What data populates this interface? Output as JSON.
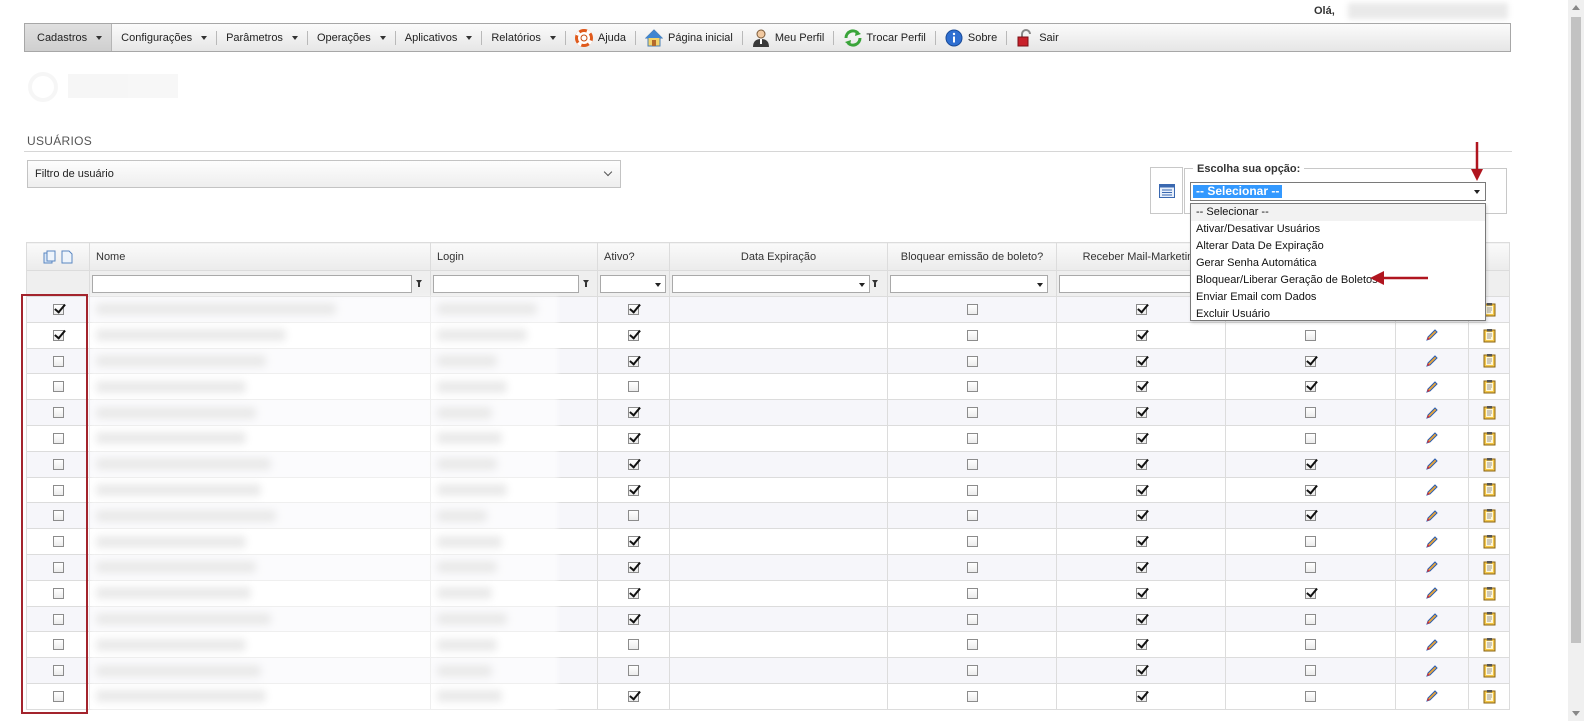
{
  "header": {
    "greeting": "Olá,"
  },
  "menu": [
    {
      "key": "cadastros",
      "label": "Cadastros",
      "caret": true,
      "icon": null
    },
    {
      "key": "configuracoes",
      "label": "Configurações",
      "caret": true,
      "icon": null
    },
    {
      "key": "parametros",
      "label": "Parâmetros",
      "caret": true,
      "icon": null
    },
    {
      "key": "operacoes",
      "label": "Operações",
      "caret": true,
      "icon": null
    },
    {
      "key": "aplicativos",
      "label": "Aplicativos",
      "caret": true,
      "icon": null
    },
    {
      "key": "relatorios",
      "label": "Relatórios",
      "caret": true,
      "icon": null
    },
    {
      "key": "ajuda",
      "label": "Ajuda",
      "caret": false,
      "icon": "lifebuoy-icon"
    },
    {
      "key": "pagina-inicial",
      "label": "Página inicial",
      "caret": false,
      "icon": "home-icon"
    },
    {
      "key": "meu-perfil",
      "label": "Meu Perfil",
      "caret": false,
      "icon": "user-icon"
    },
    {
      "key": "trocar-perfil",
      "label": "Trocar Perfil",
      "caret": false,
      "icon": "refresh-icon"
    },
    {
      "key": "sobre",
      "label": "Sobre",
      "caret": false,
      "icon": "info-icon"
    },
    {
      "key": "sair",
      "label": "Sair",
      "caret": false,
      "icon": "unlock-icon"
    }
  ],
  "page": {
    "section_title": "USUÁRIOS",
    "filter_label": "Filtro de usuário"
  },
  "actions": {
    "legend": "Escolha sua opção:",
    "selected": "-- Selecionar --",
    "options": [
      "-- Selecionar --",
      "Ativar/Desativar Usuários",
      "Alterar Data De Expiração",
      "Gerar Senha Automática",
      "Bloquear/Liberar Geração de Boletos",
      "Enviar Email com Dados",
      "Excluir Usuário"
    ]
  },
  "table": {
    "columns": [
      "",
      "Nome",
      "Login",
      "Ativo?",
      "Data Expiração",
      "Bloquear emissão de boleto?",
      "Receber Mail-Marketing",
      "",
      "",
      ""
    ],
    "rows": [
      {
        "sel": true,
        "ativo": true,
        "bloq": false,
        "mail": true,
        "col7": false
      },
      {
        "sel": true,
        "ativo": true,
        "bloq": false,
        "mail": true,
        "col7": false
      },
      {
        "sel": false,
        "ativo": true,
        "bloq": false,
        "mail": true,
        "col7": true
      },
      {
        "sel": false,
        "ativo": false,
        "bloq": false,
        "mail": true,
        "col7": true
      },
      {
        "sel": false,
        "ativo": true,
        "bloq": false,
        "mail": true,
        "col7": false
      },
      {
        "sel": false,
        "ativo": true,
        "bloq": false,
        "mail": true,
        "col7": false
      },
      {
        "sel": false,
        "ativo": true,
        "bloq": false,
        "mail": true,
        "col7": true
      },
      {
        "sel": false,
        "ativo": true,
        "bloq": false,
        "mail": true,
        "col7": true
      },
      {
        "sel": false,
        "ativo": false,
        "bloq": false,
        "mail": true,
        "col7": true
      },
      {
        "sel": false,
        "ativo": true,
        "bloq": false,
        "mail": true,
        "col7": false
      },
      {
        "sel": false,
        "ativo": true,
        "bloq": false,
        "mail": true,
        "col7": false
      },
      {
        "sel": false,
        "ativo": true,
        "bloq": false,
        "mail": true,
        "col7": true
      },
      {
        "sel": false,
        "ativo": true,
        "bloq": false,
        "mail": true,
        "col7": false
      },
      {
        "sel": false,
        "ativo": false,
        "bloq": false,
        "mail": true,
        "col7": false
      },
      {
        "sel": false,
        "ativo": false,
        "bloq": false,
        "mail": true,
        "col7": false
      },
      {
        "sel": false,
        "ativo": true,
        "bloq": false,
        "mail": true,
        "col7": false
      }
    ]
  },
  "colors": {
    "highlight": "#a3242d",
    "accent": "#3399ff",
    "arrow": "#b0151f"
  }
}
